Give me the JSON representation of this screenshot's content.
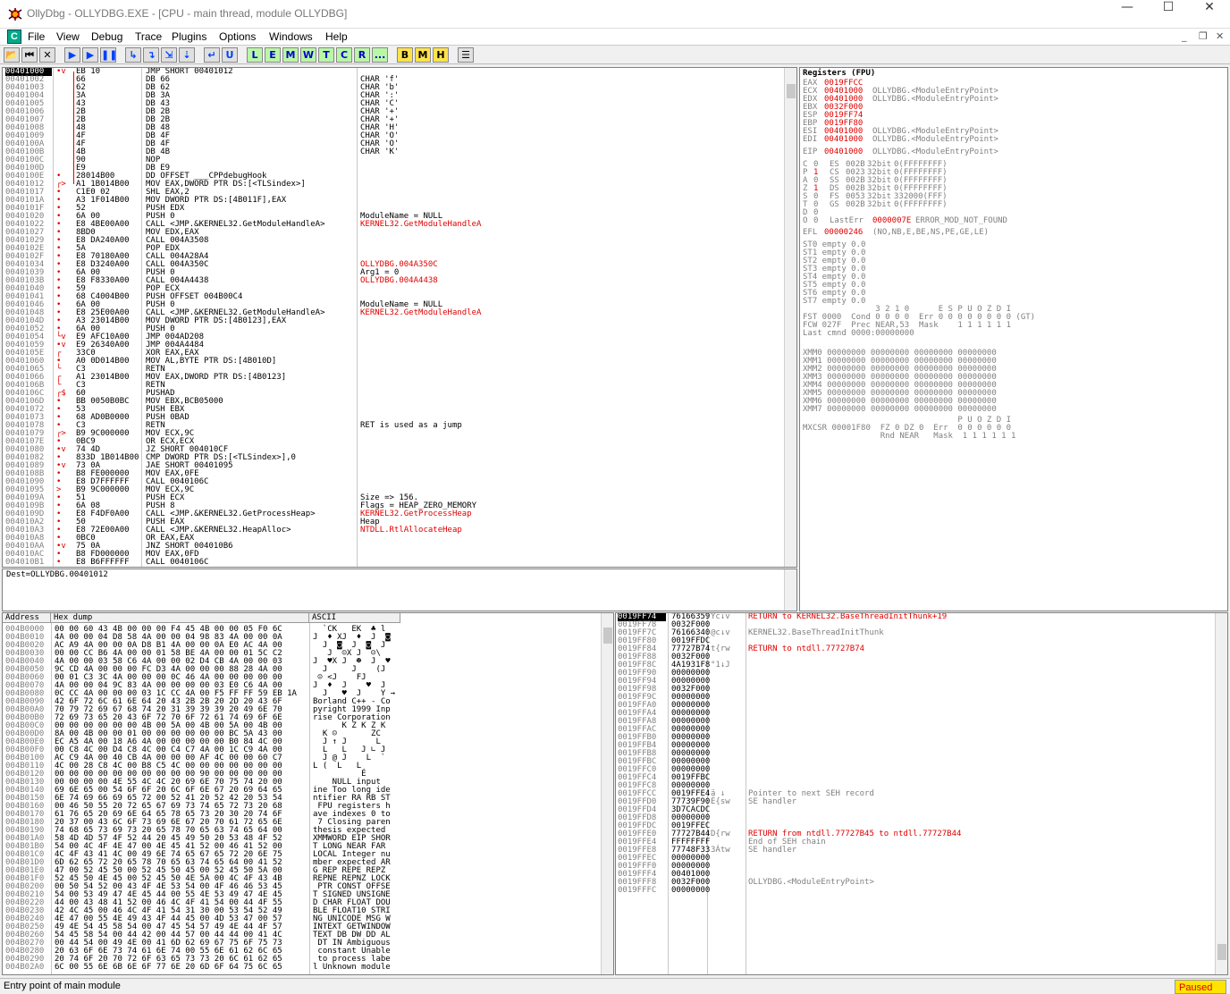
{
  "window": {
    "title": "OllyDbg - OLLYDBG.EXE - [CPU - main thread, module OLLYDBG]",
    "minimize": "—",
    "maximize": "☐",
    "close": "✕"
  },
  "menu": [
    "File",
    "View",
    "Debug",
    "Trace",
    "Plugins",
    "Options",
    "Windows",
    "Help"
  ],
  "menu_icon": "C",
  "mdi": {
    "minimize": "_",
    "restore": "❐",
    "close": "✕"
  },
  "toolbar": {
    "icons": [
      "open-icon",
      "rewind-icon",
      "close-icon",
      "run-icon",
      "run-thread-icon",
      "pause-icon",
      "step-into-icon",
      "step-over-icon",
      "trace-into-icon",
      "trace-over-icon",
      "execute-till-return-icon",
      "execute-till-user-icon"
    ],
    "symbols": [
      "📂",
      "⏮",
      "✕",
      "▶",
      "▶",
      "❚❚",
      "↳",
      "↴",
      "⇲",
      "⇣",
      "↵",
      "U"
    ],
    "letters": [
      "L",
      "E",
      "M",
      "W",
      "T",
      "C",
      "R",
      "...",
      "B",
      "M",
      "H"
    ],
    "menu_glyph": "☰"
  },
  "disasm": [
    [
      "00401000",
      "•v",
      "EB 10",
      "JMP SHORT 00401012",
      ""
    ],
    [
      "00401002",
      "",
      "66",
      "DB 66",
      "CHAR 'f'"
    ],
    [
      "00401003",
      "",
      "62",
      "DB 62",
      "CHAR 'b'"
    ],
    [
      "00401004",
      "",
      "3A",
      "DB 3A",
      "CHAR ':'"
    ],
    [
      "00401005",
      "",
      "43",
      "DB 43",
      "CHAR 'C'"
    ],
    [
      "00401006",
      "",
      "2B",
      "DB 2B",
      "CHAR '+'"
    ],
    [
      "00401007",
      "",
      "2B",
      "DB 2B",
      "CHAR '+'"
    ],
    [
      "00401008",
      "",
      "48",
      "DB 48",
      "CHAR 'H'"
    ],
    [
      "00401009",
      "",
      "4F",
      "DB 4F",
      "CHAR 'O'"
    ],
    [
      "0040100A",
      "",
      "4F",
      "DB 4F",
      "CHAR 'O'"
    ],
    [
      "0040100B",
      "",
      "4B",
      "DB 4B",
      "CHAR 'K'"
    ],
    [
      "0040100C",
      "",
      "90",
      "NOP",
      ""
    ],
    [
      "0040100D",
      "",
      "E9",
      "DB E9",
      ""
    ],
    [
      "0040100E",
      "•",
      "28014B00",
      "DD OFFSET ___CPPdebugHook",
      ""
    ],
    [
      "00401012",
      "┌>",
      "A1 1B014B00",
      "MOV EAX,DWORD PTR DS:[<TLSindex>]",
      ""
    ],
    [
      "00401017",
      "•",
      "C1E0 02",
      "SHL EAX,2",
      ""
    ],
    [
      "0040101A",
      "•",
      "A3 1F014B00",
      "MOV DWORD PTR DS:[4B011F],EAX",
      ""
    ],
    [
      "0040101F",
      "•",
      "52",
      "PUSH EDX",
      ""
    ],
    [
      "00401020",
      "•",
      "6A 00",
      "PUSH 0",
      "ModuleName = NULL"
    ],
    [
      "00401022",
      "•",
      "E8 4BE00A00",
      "CALL <JMP.&KERNEL32.GetModuleHandleA>",
      "KERNEL32.GetModuleHandleA"
    ],
    [
      "00401027",
      "•",
      "8BD0",
      "MOV EDX,EAX",
      ""
    ],
    [
      "00401029",
      "•",
      "E8 DA240A00",
      "CALL 004A3508",
      ""
    ],
    [
      "0040102E",
      "•",
      "5A",
      "POP EDX",
      ""
    ],
    [
      "0040102F",
      "•",
      "E8 70180A00",
      "CALL 004A28A4",
      ""
    ],
    [
      "00401034",
      "•",
      "E8 D3240A00",
      "CALL 004A350C",
      "OLLYDBG.004A350C"
    ],
    [
      "00401039",
      "•",
      "6A 00",
      "PUSH 0",
      "Arg1 = 0"
    ],
    [
      "0040103B",
      "•",
      "E8 F8330A00",
      "CALL 004A4438",
      "OLLYDBG.004A4438"
    ],
    [
      "00401040",
      "•",
      "59",
      "POP ECX",
      ""
    ],
    [
      "00401041",
      "•",
      "68 C4004B00",
      "PUSH OFFSET 004B00C4",
      ""
    ],
    [
      "00401046",
      "•",
      "6A 00",
      "PUSH 0",
      "ModuleName = NULL"
    ],
    [
      "00401048",
      "•",
      "E8 25E00A00",
      "CALL <JMP.&KERNEL32.GetModuleHandleA>",
      "KERNEL32.GetModuleHandleA"
    ],
    [
      "0040104D",
      "•",
      "A3 23014B00",
      "MOV DWORD PTR DS:[4B0123],EAX",
      ""
    ],
    [
      "00401052",
      "•",
      "6A 00",
      "PUSH 0",
      ""
    ],
    [
      "00401054",
      "└v",
      "E9 AFC10A00",
      "JMP 004AD208",
      ""
    ],
    [
      "00401059",
      "•v",
      "E9 26340A00",
      "JMP 004A4484",
      ""
    ],
    [
      "0040105E",
      "┌",
      "33C0",
      "XOR EAX,EAX",
      ""
    ],
    [
      "00401060",
      "•",
      "A0 0D014B00",
      "MOV AL,BYTE PTR DS:[4B010D]",
      ""
    ],
    [
      "00401065",
      "└",
      "C3",
      "RETN",
      ""
    ],
    [
      "00401066",
      "┌",
      "A1 23014B00",
      "MOV EAX,DWORD PTR DS:[4B0123]",
      ""
    ],
    [
      "0040106B",
      "└",
      "C3",
      "RETN",
      ""
    ],
    [
      "0040106C",
      "┌$",
      "60",
      "PUSHAD",
      ""
    ],
    [
      "0040106D",
      "•",
      "BB 0050B0BC",
      "MOV EBX,BCB05000",
      ""
    ],
    [
      "00401072",
      "•",
      "53",
      "PUSH EBX",
      ""
    ],
    [
      "00401073",
      "•",
      "68 AD0B0000",
      "PUSH 0BAD",
      ""
    ],
    [
      "00401078",
      "•",
      "C3",
      "RETN",
      "RET is used as a jump"
    ],
    [
      "00401079",
      "┌>",
      "B9 9C000000",
      "MOV ECX,9C",
      ""
    ],
    [
      "0040107E",
      "•",
      "0BC9",
      "OR ECX,ECX",
      ""
    ],
    [
      "00401080",
      "•v",
      "74 4D",
      "JZ SHORT 004010CF",
      ""
    ],
    [
      "00401082",
      "•",
      "833D 1B014B00",
      "CMP DWORD PTR DS:[<TLSindex>],0",
      ""
    ],
    [
      "00401089",
      "•v",
      "73 0A",
      "JAE SHORT 00401095",
      ""
    ],
    [
      "0040108B",
      "•",
      "B8 FE000000",
      "MOV EAX,0FE",
      ""
    ],
    [
      "00401090",
      "•",
      "E8 D7FFFFFF",
      "CALL 0040106C",
      ""
    ],
    [
      "00401095",
      ">",
      "B9 9C000000",
      "MOV ECX,9C",
      ""
    ],
    [
      "0040109A",
      "•",
      "51",
      "PUSH ECX",
      "Size => 156."
    ],
    [
      "0040109B",
      "•",
      "6A 08",
      "PUSH 8",
      "Flags = HEAP_ZERO_MEMORY"
    ],
    [
      "0040109D",
      "•",
      "E8 F4DF0A00",
      "CALL <JMP.&KERNEL32.GetProcessHeap>",
      "KERNEL32.GetProcessHeap"
    ],
    [
      "004010A2",
      "•",
      "50",
      "PUSH EAX",
      "Heap"
    ],
    [
      "004010A3",
      "•",
      "E8 72E00A00",
      "CALL <JMP.&KERNEL32.HeapAlloc>",
      "NTDLL.RtlAllocateHeap"
    ],
    [
      "004010A8",
      "•",
      "0BC0",
      "OR EAX,EAX",
      ""
    ],
    [
      "004010AA",
      "•v",
      "75 0A",
      "JNZ SHORT 004010B6",
      ""
    ],
    [
      "004010AC",
      "•",
      "B8 FD000000",
      "MOV EAX,0FD",
      ""
    ],
    [
      "004010B1",
      "•",
      "E8 B6FFFFFF",
      "CALL 0040106C",
      ""
    ]
  ],
  "info_line": "Dest=OLLYDBG.00401012",
  "registers": {
    "header": "Registers (FPU)",
    "gp": [
      [
        "EAX",
        "0019FFCC",
        ""
      ],
      [
        "ECX",
        "00401000",
        "OLLYDBG.<ModuleEntryPoint>"
      ],
      [
        "EDX",
        "00401000",
        "OLLYDBG.<ModuleEntryPoint>"
      ],
      [
        "EBX",
        "0032F000",
        ""
      ],
      [
        "ESP",
        "0019FF74",
        ""
      ],
      [
        "EBP",
        "0019FF80",
        ""
      ],
      [
        "ESI",
        "00401000",
        "OLLYDBG.<ModuleEntryPoint>"
      ],
      [
        "EDI",
        "00401000",
        "OLLYDBG.<ModuleEntryPoint>"
      ]
    ],
    "eip": [
      "EIP",
      "00401000",
      "OLLYDBG.<ModuleEntryPoint>"
    ],
    "flags": [
      [
        "C",
        "0",
        "ES",
        "002B",
        "32bit",
        "0(FFFFFFFF)"
      ],
      [
        "P",
        "1",
        "CS",
        "0023",
        "32bit",
        "0(FFFFFFFF)"
      ],
      [
        "A",
        "0",
        "SS",
        "002B",
        "32bit",
        "0(FFFFFFFF)"
      ],
      [
        "Z",
        "1",
        "DS",
        "002B",
        "32bit",
        "0(FFFFFFFF)"
      ],
      [
        "S",
        "0",
        "FS",
        "0053",
        "32bit",
        "332000(FFF)"
      ],
      [
        "T",
        "0",
        "GS",
        "002B",
        "32bit",
        "0(FFFFFFFF)"
      ],
      [
        "D",
        "0",
        "",
        "",
        "",
        ""
      ],
      [
        "O",
        "0",
        "LastErr",
        "0000007E",
        "ERROR_MOD_NOT_FOUND",
        ""
      ]
    ],
    "efl": [
      "EFL",
      "00000246",
      "(NO,NB,E,BE,NS,PE,GE,LE)"
    ],
    "st": [
      "ST0 empty 0.0",
      "ST1 empty 0.0",
      "ST2 empty 0.0",
      "ST3 empty 0.0",
      "ST4 empty 0.0",
      "ST5 empty 0.0",
      "ST6 empty 0.0",
      "ST7 empty 0.0"
    ],
    "fpu": [
      "               3 2 1 0      E S P U O Z D I",
      "FST 0000  Cond 0 0 0 0  Err 0 0 0 0 0 0 0 0 (GT)",
      "FCW 027F  Prec NEAR,53  Mask    1 1 1 1 1 1",
      "Last cmnd 0000:00000000"
    ],
    "xmm": [
      "XMM0 00000000 00000000 00000000 00000000",
      "XMM1 00000000 00000000 00000000 00000000",
      "XMM2 00000000 00000000 00000000 00000000",
      "XMM3 00000000 00000000 00000000 00000000",
      "XMM4 00000000 00000000 00000000 00000000",
      "XMM5 00000000 00000000 00000000 00000000",
      "XMM6 00000000 00000000 00000000 00000000",
      "XMM7 00000000 00000000 00000000 00000000"
    ],
    "mxcsr": [
      "                                P U O Z D I",
      "MXCSR 00001F80  FZ 0 DZ 0  Err  0 0 0 0 0 0",
      "                Rnd NEAR   Mask  1 1 1 1 1 1"
    ]
  },
  "dump": {
    "headers": [
      "Address",
      "Hex dump",
      "ASCII"
    ],
    "rows": [
      [
        "004B0000",
        "00 00 60 43 4B 00 00 00 F4 45 4B 00 00 05 F0 6C",
        "  `CK   EK  ♣ l"
      ],
      [
        "004B0010",
        "4A 00 00 04 D8 58 4A 00 00 04 98 83 4A 00 00 0A",
        "J  ♦ XJ  ♦  J  ◙"
      ],
      [
        "004B0020",
        "AC A9 4A 00 00 0A D8 B1 4A 00 00 0A E0 AC 4A 00",
        "  J  ◙  J  ◙  J"
      ],
      [
        "004B0030",
        "00 00 CC B6 4A 00 00 01 58 BE 4A 00 00 01 5C C2",
        "   J  ☺X J  ☺\\"
      ],
      [
        "004B0040",
        "4A 00 00 03 58 C6 4A 00 00 02 D4 CB 4A 00 00 03",
        "J  ♥X J  ☻  J  ♥"
      ],
      [
        "004B0050",
        "9C CD 4A 00 00 00 FC D3 4A 00 00 00 88 28 4A 00",
        "  J     J    (J"
      ],
      [
        "004B0060",
        "00 01 C3 3C 4A 00 00 00 0C 46 4A 00 00 00 00 00",
        " ☺ <J    FJ"
      ],
      [
        "004B0070",
        "4A 00 00 04 9C 83 4A 00 00 00 00 03 E0 C6 4A 00",
        "J  ♦  J    ♥  J"
      ],
      [
        "004B0080",
        "0C CC 4A 00 00 00 03 1C CC 4A 00 F5 FF FF 59 EB 1A",
        "  J   ♥  J    Y →"
      ],
      [
        "004B0090",
        "42 6F 72 6C 61 6E 64 20 43 2B 2B 20 2D 20 43 6F",
        "Borland C++ - Co"
      ],
      [
        "004B00A0",
        "70 79 72 69 67 68 74 20 31 39 39 39 20 49 6E 70",
        "pyright 1999 Inp"
      ],
      [
        "004B00B0",
        "72 69 73 65 20 43 6F 72 70 6F 72 61 74 69 6F 6E",
        "rise Corporation"
      ],
      [
        "004B00C0",
        "00 00 00 00 00 00 4B 00 5A 00 4B 00 5A 00 4B 00",
        "      K Z K Z K"
      ],
      [
        "004B00D0",
        "8A 00 4B 00 00 01 00 00 00 00 00 00 BC 5A 43 00",
        "  K ☺       ZC"
      ],
      [
        "004B00E0",
        "EC A5 4A 00 18 A6 4A 00 00 00 00 00 B0 84 4C 00",
        "  J ↑ J      L"
      ],
      [
        "004B00F0",
        "00 C8 4C 00 D4 C8 4C 00 C4 C7 4A 00 1C C9 4A 00",
        "  L   L   J ∟ J"
      ],
      [
        "004B0100",
        "AC C9 4A 00 40 CB 4A 00 00 00 AF 4C 00 00 60 C7",
        "  J @ J    L  `"
      ],
      [
        "004B0110",
        "4C 00 28 C8 4C 00 B8 C5 4C 00 00 00 00 00 00 00",
        "L (  L   L"
      ],
      [
        "004B0120",
        "00 00 00 00 00 00 00 00 00 00 90 00 00 00 00 00",
        "          É"
      ],
      [
        "004B0130",
        "00 00 00 00 4E 55 4C 4C 20 69 6E 70 75 74 20 00",
        "    NULL input"
      ],
      [
        "004B0140",
        "69 6E 65 00 54 6F 6F 20 6C 6F 6E 67 20 69 64 65",
        "ine Too long ide"
      ],
      [
        "004B0150",
        "6E 74 69 66 69 65 72 00 52 41 20 52 42 20 53 54",
        "ntifier RA RB ST"
      ],
      [
        "004B0160",
        "00 46 50 55 20 72 65 67 69 73 74 65 72 73 20 68",
        " FPU registers h"
      ],
      [
        "004B0170",
        "61 76 65 20 69 6E 64 65 78 65 73 20 30 20 74 6F",
        "ave indexes 0 to"
      ],
      [
        "004B0180",
        "20 37 00 43 6C 6F 73 69 6E 67 20 70 61 72 65 6E",
        " 7 Closing paren"
      ],
      [
        "004B0190",
        "74 68 65 73 69 73 20 65 78 70 65 63 74 65 64 00",
        "thesis expected"
      ],
      [
        "004B01A0",
        "58 4D 4D 57 4F 52 44 20 45 49 50 20 53 48 4F 52",
        "XMMWORD EIP SHOR"
      ],
      [
        "004B01B0",
        "54 00 4C 4F 4E 47 00 4E 45 41 52 00 46 41 52 00",
        "T LONG NEAR FAR"
      ],
      [
        "004B01C0",
        "4C 4F 43 41 4C 00 49 6E 74 65 67 65 72 20 6E 75",
        "LOCAL Integer nu"
      ],
      [
        "004B01D0",
        "6D 62 65 72 20 65 78 70 65 63 74 65 64 00 41 52",
        "mber expected AR"
      ],
      [
        "004B01E0",
        "47 00 52 45 50 00 52 45 50 45 00 52 45 50 5A 00",
        "G REP REPE REPZ"
      ],
      [
        "004B01F0",
        "52 45 50 4E 45 00 52 45 50 4E 5A 00 4C 4F 43 4B",
        "REPNE REPNZ LOCK"
      ],
      [
        "004B0200",
        "00 50 54 52 00 43 4F 4E 53 54 00 4F 46 46 53 45",
        " PTR CONST OFFSE"
      ],
      [
        "004B0210",
        "54 00 53 49 47 4E 45 44 00 55 4E 53 49 47 4E 45",
        "T SIGNED UNSIGNE"
      ],
      [
        "004B0220",
        "44 00 43 48 41 52 00 46 4C 4F 41 54 00 44 4F 55",
        "D CHAR FLOAT DOU"
      ],
      [
        "004B0230",
        "42 4C 45 00 46 4C 4F 41 54 31 30 00 53 54 52 49",
        "BLE FLOAT10 STRI"
      ],
      [
        "004B0240",
        "4E 47 00 55 4E 49 43 4F 44 45 00 4D 53 47 00 57",
        "NG UNICODE MSG W"
      ],
      [
        "004B0250",
        "49 4E 54 45 58 54 00 47 45 54 57 49 4E 44 4F 57",
        "INTEXT GETWINDOW"
      ],
      [
        "004B0260",
        "54 45 58 54 00 44 42 00 44 57 00 44 44 00 41 4C",
        "TEXT DB DW DD AL"
      ],
      [
        "004B0270",
        "00 44 54 00 49 4E 00 41 6D 62 69 67 75 6F 75 73",
        " DT IN Ambiguous"
      ],
      [
        "004B0280",
        "20 63 6F 6E 73 74 61 6E 74 00 55 6E 61 62 6C 65",
        " constant Unable"
      ],
      [
        "004B0290",
        "20 74 6F 20 70 72 6F 63 65 73 73 20 6C 61 62 65",
        " to process labe"
      ],
      [
        "004B02A0",
        "6C 00 55 6E 6B 6E 6F 77 6E 20 6D 6F 64 75 6C 65",
        "l Unknown module"
      ]
    ]
  },
  "stack": [
    [
      "0019FF74",
      "76166359",
      "Yc↓v",
      "RETURN to KERNEL32.BaseThreadInitThunk+19"
    ],
    [
      "0019FF78",
      "0032F000",
      "",
      ""
    ],
    [
      "0019FF7C",
      "76166340",
      "@c↓v",
      "KERNEL32.BaseThreadInitThunk"
    ],
    [
      "0019FF80",
      "0019FFDC",
      "",
      ""
    ],
    [
      "0019FF84",
      "77727B74",
      "t{rw",
      "RETURN to ntdll.77727B74"
    ],
    [
      "0019FF88",
      "0032F000",
      "",
      ""
    ],
    [
      "0019FF8C",
      "4A1931F8",
      "°1↓J",
      ""
    ],
    [
      "0019FF90",
      "00000000",
      "",
      ""
    ],
    [
      "0019FF94",
      "00000000",
      "",
      ""
    ],
    [
      "0019FF98",
      "0032F000",
      "",
      ""
    ],
    [
      "0019FF9C",
      "00000000",
      "",
      ""
    ],
    [
      "0019FFA0",
      "00000000",
      "",
      ""
    ],
    [
      "0019FFA4",
      "00000000",
      "",
      ""
    ],
    [
      "0019FFA8",
      "00000000",
      "",
      ""
    ],
    [
      "0019FFAC",
      "00000000",
      "",
      ""
    ],
    [
      "0019FFB0",
      "00000000",
      "",
      ""
    ],
    [
      "0019FFB4",
      "00000000",
      "",
      ""
    ],
    [
      "0019FFB8",
      "00000000",
      "",
      ""
    ],
    [
      "0019FFBC",
      "00000000",
      "",
      ""
    ],
    [
      "0019FFC0",
      "00000000",
      "",
      ""
    ],
    [
      "0019FFC4",
      "0019FFBC",
      "",
      ""
    ],
    [
      "0019FFC8",
      "00000000",
      "",
      ""
    ],
    [
      "0019FFCC",
      "0019FFE4",
      "ä ↓",
      "Pointer to next SEH record"
    ],
    [
      "0019FFD0",
      "77739F90",
      "É{sw",
      "SE handler"
    ],
    [
      "0019FFD4",
      "3D7CACDC",
      "",
      ""
    ],
    [
      "0019FFD8",
      "00000000",
      "",
      ""
    ],
    [
      "0019FFDC",
      "0019FFEC",
      "",
      ""
    ],
    [
      "0019FFE0",
      "77727B44",
      "D{rw",
      "RETURN from ntdll.77727B45 to ntdll.77727B44"
    ],
    [
      "0019FFE4",
      "FFFFFFFF",
      "",
      "End of SEH chain"
    ],
    [
      "0019FFE8",
      "77748F33",
      "3Átw",
      "SE handler"
    ],
    [
      "0019FFEC",
      "00000000",
      "",
      ""
    ],
    [
      "0019FFF0",
      "00000000",
      "",
      ""
    ],
    [
      "0019FFF4",
      "00401000",
      "",
      ""
    ],
    [
      "0019FFF8",
      "0032F000",
      "",
      "OLLYDBG.<ModuleEntryPoint>"
    ],
    [
      "0019FFFC",
      "00000000",
      "",
      ""
    ]
  ],
  "status": {
    "message": "Entry point of main module",
    "state": "Paused"
  }
}
